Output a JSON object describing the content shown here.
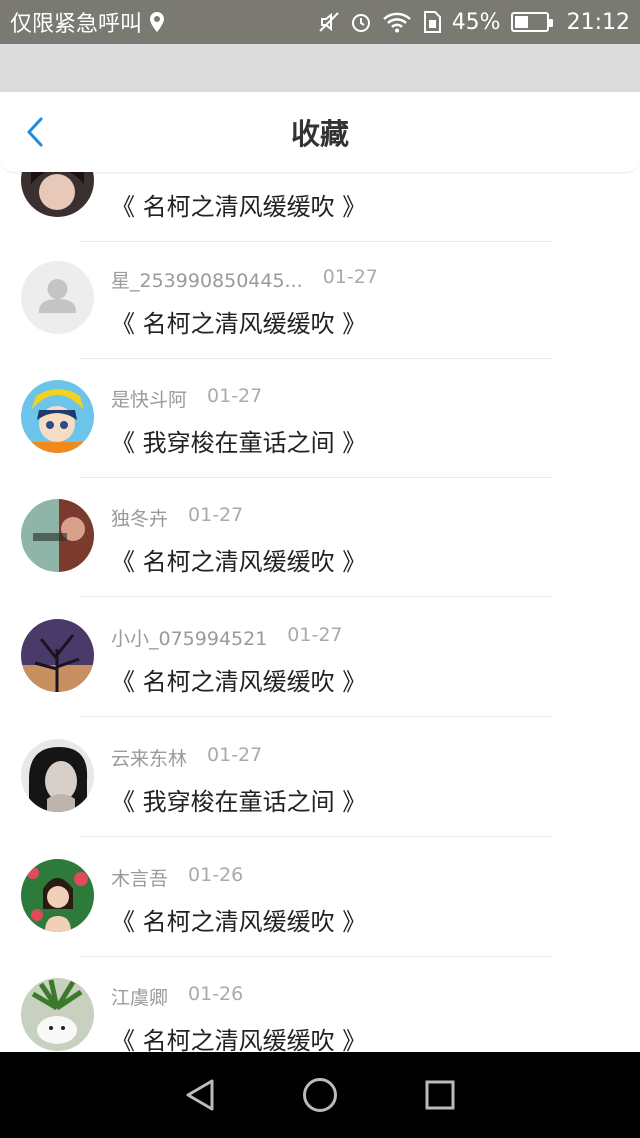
{
  "status_bar": {
    "carrier": "仅限紧急呼叫",
    "battery_percent": "45%",
    "battery_level": 0.45,
    "time": "21:12",
    "icons": [
      "location-icon",
      "mute-icon",
      "alarm-icon",
      "wifi-icon",
      "sim-icon",
      "battery-icon"
    ]
  },
  "header": {
    "title": "收藏",
    "back_icon": "chevron-left-icon",
    "accent": "#1a8be0"
  },
  "items": [
    {
      "user": "",
      "date": "",
      "book": "《 名柯之清风缓缓吹 》"
    },
    {
      "user": "星_253990850445...",
      "date": "01-27",
      "book": "《 名柯之清风缓缓吹 》"
    },
    {
      "user": "是快斗阿",
      "date": "01-27",
      "book": "《 我穿梭在童话之间 》"
    },
    {
      "user": "独冬卉",
      "date": "01-27",
      "book": "《 名柯之清风缓缓吹 》"
    },
    {
      "user": "小小_075994521",
      "date": "01-27",
      "book": "《 名柯之清风缓缓吹 》"
    },
    {
      "user": "云来东林",
      "date": "01-27",
      "book": "《 我穿梭在童话之间 》"
    },
    {
      "user": "木言吾",
      "date": "01-26",
      "book": "《 名柯之清风缓缓吹 》"
    },
    {
      "user": "江虞卿",
      "date": "01-26",
      "book": "《 名柯之清风缓缓吹 》"
    }
  ],
  "nav": {
    "back": "triangle-back-icon",
    "home": "circle-home-icon",
    "recents": "square-recents-icon"
  }
}
